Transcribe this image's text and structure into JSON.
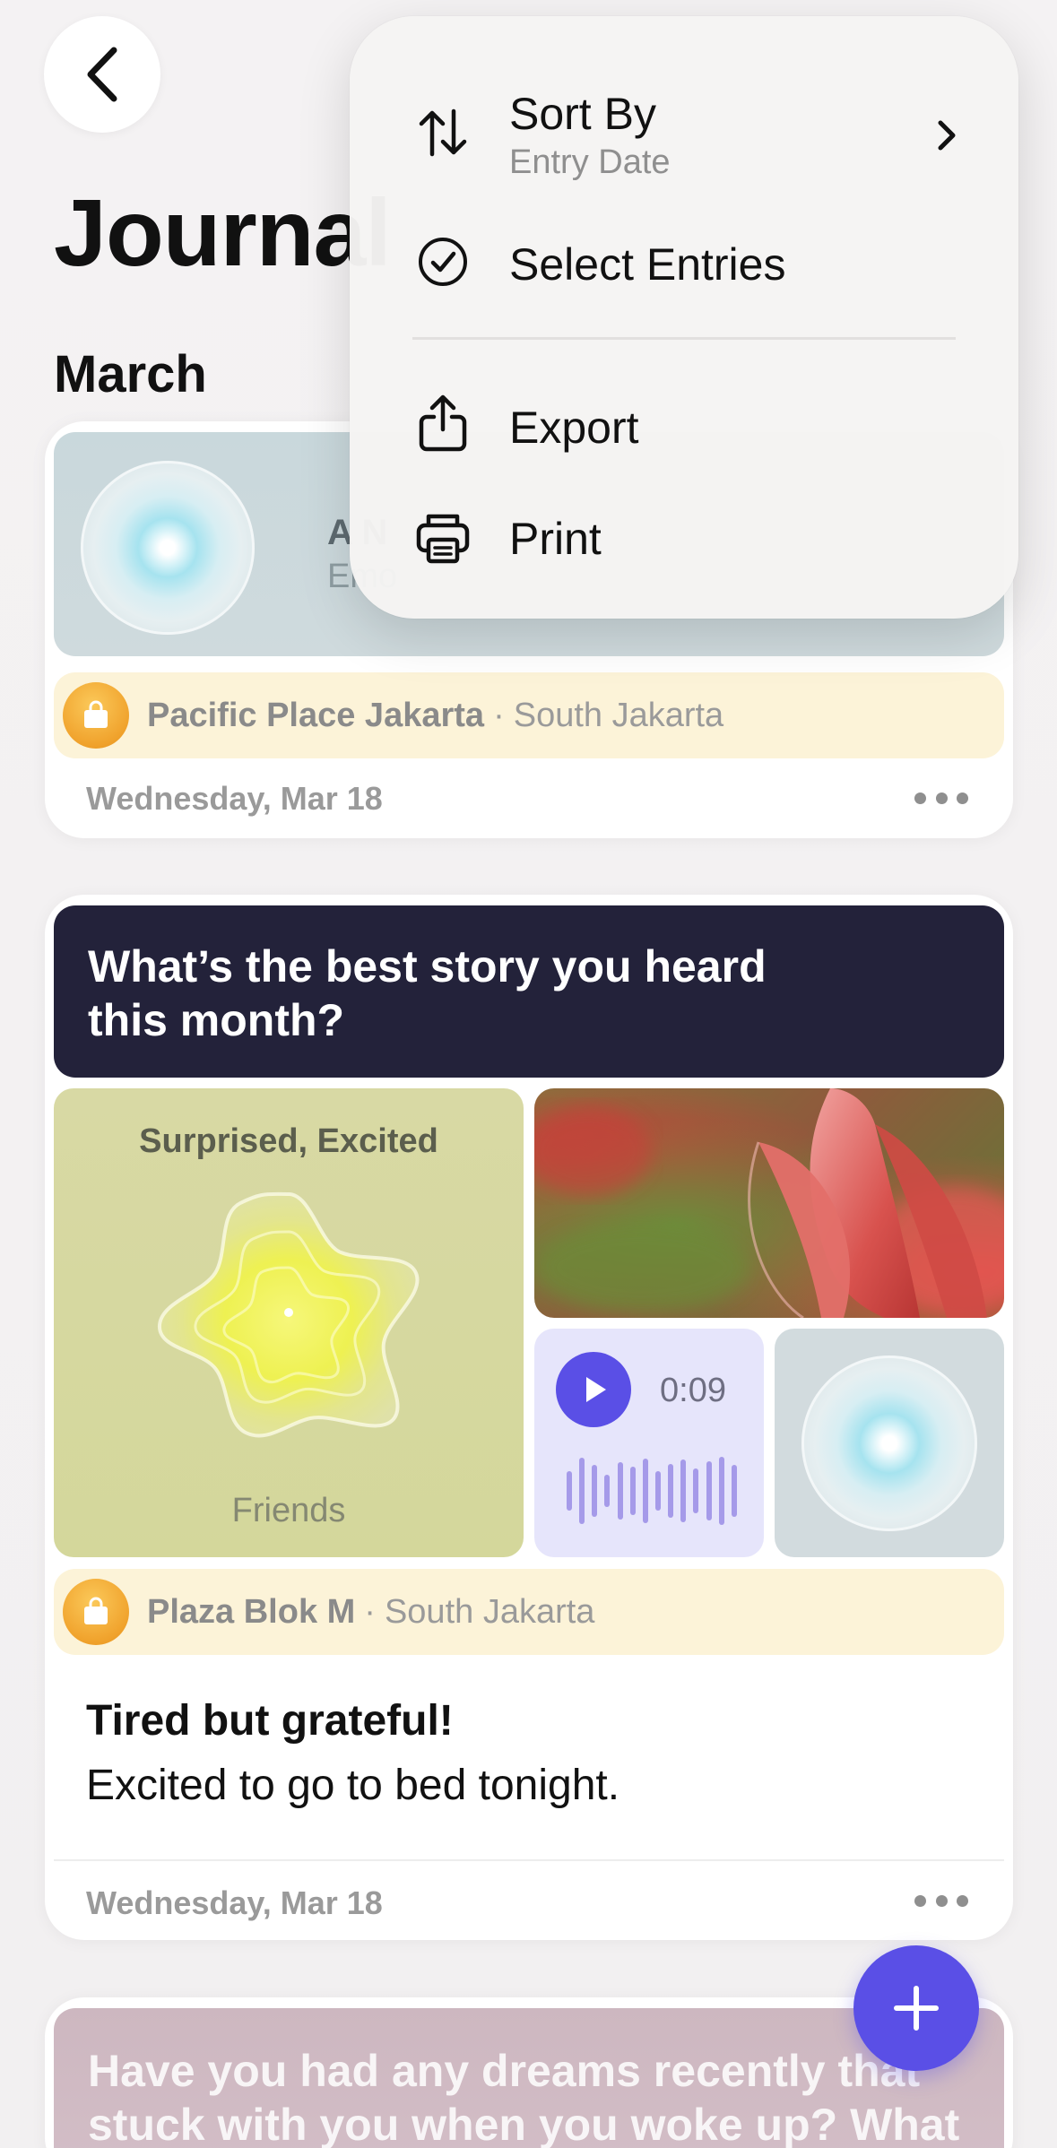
{
  "header": {
    "title": "Journal",
    "back_icon": "chevron-left-icon"
  },
  "sections": [
    {
      "month": "March"
    }
  ],
  "entries": [
    {
      "head_title": "A N",
      "head_subtitle": "Emo",
      "location": {
        "name": "Pacific Place Jakarta",
        "separator": "·",
        "area": "South Jakarta"
      },
      "date": "Wednesday, Mar 18"
    },
    {
      "prompt": "What’s the best story you heard this month?",
      "mood": {
        "label": "Surprised, Excited",
        "context": "Friends"
      },
      "audio": {
        "duration": "0:09"
      },
      "location": {
        "name": "Plaza Blok M",
        "separator": "·",
        "area": "South Jakarta"
      },
      "title": "Tired but grateful!",
      "body": "Excited to go to bed tonight.",
      "date": "Wednesday, Mar 18"
    },
    {
      "prompt": "Have you had any dreams recently that stuck with you when you woke up? What"
    }
  ],
  "menu": {
    "sort_by": {
      "label": "Sort By",
      "value": "Entry Date"
    },
    "select_entries": "Select Entries",
    "export": "Export",
    "print": "Print"
  },
  "colors": {
    "accent": "#5a4fe6",
    "prompt_banner": "#23223a",
    "location_bar": "#fcf3d8",
    "mood_tile": "#d6d89f"
  }
}
